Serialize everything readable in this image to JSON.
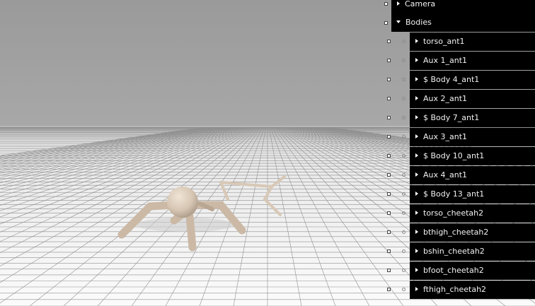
{
  "viewer": {
    "scene": "3d-simulation-viewport",
    "background_color": "#9e9e9e",
    "floor_color": "#f4f4f4",
    "body_color": "#d8c8b6"
  },
  "panel": {
    "camera_label": "Camera",
    "bodies_label": "Bodies",
    "bodies": [
      "torso_ant1",
      "Aux 1_ant1",
      "$ Body 4_ant1",
      "Aux 2_ant1",
      "$ Body 7_ant1",
      "Aux 3_ant1",
      "$ Body 10_ant1",
      "Aux 4_ant1",
      "$ Body 13_ant1",
      "torso_cheetah2",
      "bthigh_cheetah2",
      "bshin_cheetah2",
      "bfoot_cheetah2",
      "fthigh_cheetah2"
    ]
  }
}
